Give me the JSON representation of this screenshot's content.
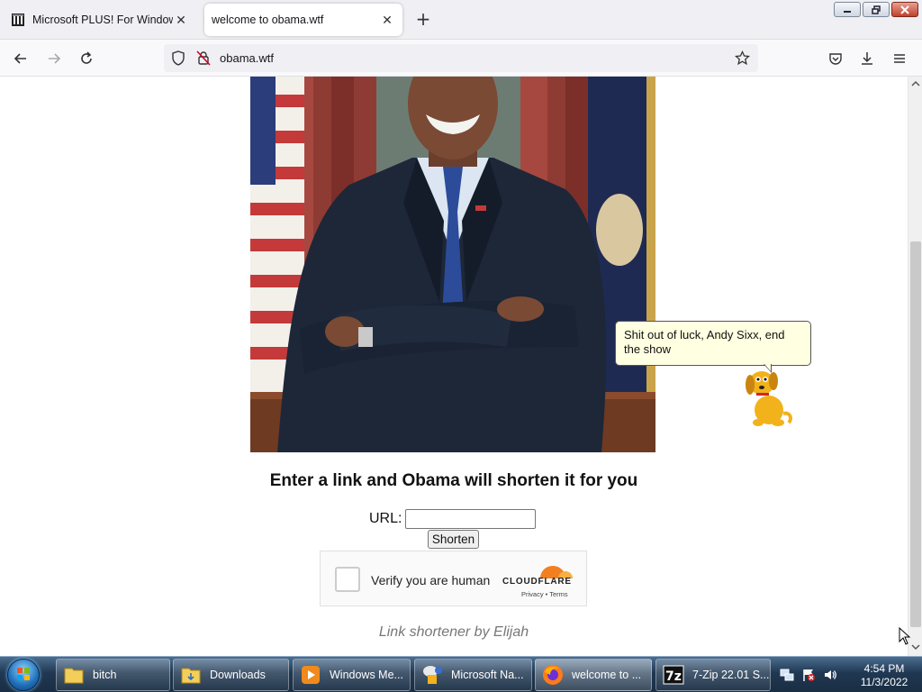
{
  "browser": {
    "tabs": [
      {
        "title": "Microsoft PLUS! For Windows XP",
        "active": false
      },
      {
        "title": "welcome to obama.wtf",
        "active": true
      }
    ],
    "new_tab_symbol": "+",
    "url": "obama.wtf",
    "icons": [
      "back-icon",
      "forward-icon",
      "reload-icon",
      "tracking-shield-icon",
      "lock-insecure-icon",
      "bookmark-star-icon",
      "pocket-icon",
      "download-icon",
      "menu-icon"
    ]
  },
  "page": {
    "heading": "Enter a link and Obama will shorten it for you",
    "url_label": "URL:",
    "url_value": "",
    "shorten_label": "Shorten",
    "captcha": {
      "text": "Verify you are human",
      "brand": "CLOUDFLARE",
      "links": "Privacy  •  Terms",
      "brand_color": "#f38020"
    },
    "credit": "Link shortener by Elijah"
  },
  "assistant": {
    "message": "Shit out of luck, Andy Sixx, end the show"
  },
  "taskbar": {
    "items": [
      {
        "label": "bitch",
        "icon": "folder-icon"
      },
      {
        "label": "Downloads",
        "icon": "folder-icon"
      },
      {
        "label": "Windows Me...",
        "icon": "media-player-icon"
      },
      {
        "label": "Microsoft Na...",
        "icon": "agent-icon"
      },
      {
        "label": "welcome to ...",
        "icon": "firefox-icon"
      },
      {
        "label": "7-Zip 22.01 S...",
        "icon": "7zip-icon"
      }
    ],
    "clock_time": "4:54 PM",
    "clock_date": "11/3/2022"
  }
}
